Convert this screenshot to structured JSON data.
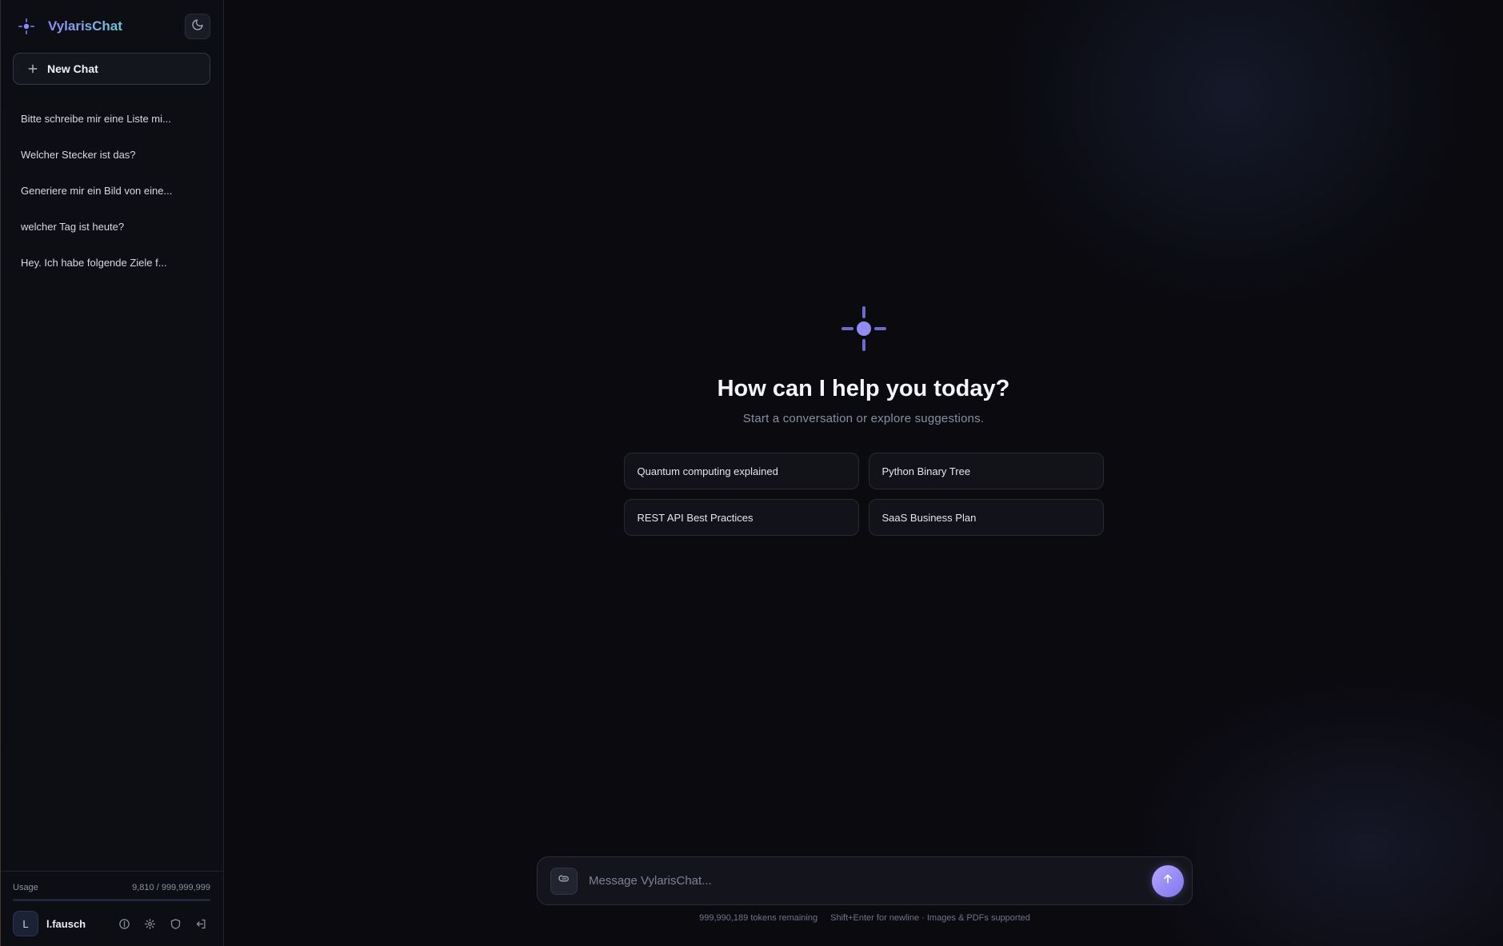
{
  "app": {
    "brand": "VylarisChat"
  },
  "sidebar": {
    "new_chat_label": "New Chat",
    "history": [
      "Bitte schreibe mir eine Liste mi...",
      "Welcher Stecker ist das?",
      "Generiere mir ein Bild von eine...",
      "welcher Tag ist heute?",
      "Hey. Ich habe folgende Ziele f..."
    ],
    "usage": {
      "label": "Usage",
      "value": "9,810 / 999,999,999",
      "fraction": 9.8e-06
    },
    "user": {
      "initial": "L",
      "name": "l.fausch"
    }
  },
  "main": {
    "title": "How can I help you today?",
    "subtitle": "Start a conversation or explore suggestions.",
    "suggestions": [
      "Quantum computing explained",
      "Python Binary Tree",
      "REST API Best Practices",
      "SaaS Business Plan"
    ],
    "composer": {
      "placeholder": "Message VylarisChat...",
      "tokens_remaining": "999,990,189 tokens remaining",
      "hint": "Shift+Enter for newline · Images & PDFs supported"
    }
  },
  "icons": {
    "brand": "sparkle-icon",
    "theme": "moon-icon",
    "new_chat": "plus-icon",
    "info": "info-icon",
    "settings": "gear-icon",
    "admin": "shield-icon",
    "logout": "logout-icon",
    "attach": "paperclip-icon",
    "send": "arrow-up-icon"
  },
  "colors": {
    "accent": "#8f8cf4",
    "accent_secondary": "#6fc4d8",
    "background": "#0a0a0f",
    "sidebar": "#0d0e14"
  }
}
